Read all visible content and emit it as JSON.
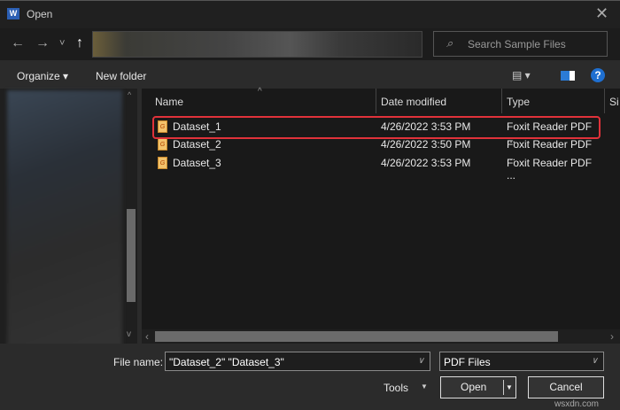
{
  "window": {
    "title": "Open",
    "app_icon": "W"
  },
  "nav": {
    "back": "←",
    "forward": "→",
    "recent": "˅",
    "up": "↑",
    "search_placeholder": "Search Sample Files"
  },
  "toolbar": {
    "organize": "Organize ▾",
    "new_folder": "New folder",
    "view": "▤ ▾",
    "help": "?"
  },
  "columns": [
    "Name",
    "Date modified",
    "Type",
    "Si"
  ],
  "files": [
    {
      "name": "Dataset_1",
      "date": "4/26/2022 3:53 PM",
      "type": "Foxit Reader PDF ..."
    },
    {
      "name": "Dataset_2",
      "date": "4/26/2022 3:50 PM",
      "type": "Foxit Reader PDF ..."
    },
    {
      "name": "Dataset_3",
      "date": "4/26/2022 3:53 PM",
      "type": "Foxit Reader PDF ..."
    }
  ],
  "bottom": {
    "file_name_label": "File name:",
    "file_name_value": "\"Dataset_2\" \"Dataset_3\"",
    "filter": "PDF Files",
    "tools": "Tools",
    "open": "Open",
    "cancel": "Cancel"
  },
  "watermark": "wsxdn.com",
  "colors": {
    "highlight": "#e0323a"
  }
}
